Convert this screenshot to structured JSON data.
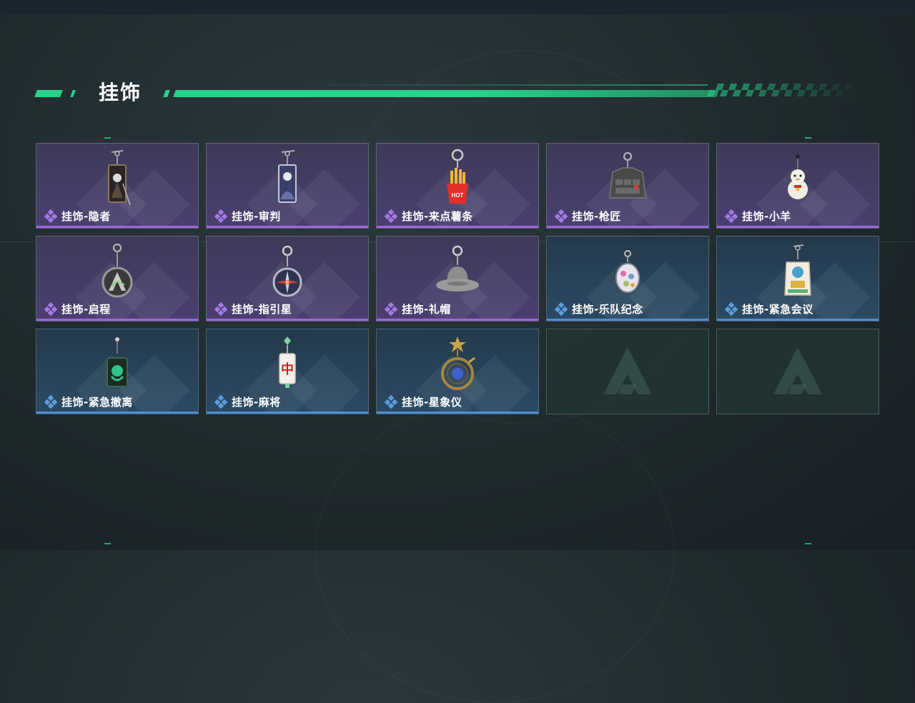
{
  "header": {
    "title": "挂饰"
  },
  "colors": {
    "accent": "#27d38b",
    "rare_purple": "#9a67e0",
    "rare_blue": "#4f8ed0"
  },
  "items": [
    {
      "label": "挂饰-隐者",
      "rarity": "purple",
      "icon": "tarot-card-hermit-charm-icon"
    },
    {
      "label": "挂饰-审判",
      "rarity": "purple",
      "icon": "tarot-card-judgement-charm-icon"
    },
    {
      "label": "挂饰-来点薯条",
      "rarity": "purple",
      "icon": "french-fries-charm-icon",
      "icon_text": "HOT"
    },
    {
      "label": "挂饰-枪匠",
      "rarity": "purple",
      "icon": "gunsmith-vest-charm-icon"
    },
    {
      "label": "挂饰-小羊",
      "rarity": "purple",
      "icon": "little-sheep-charm-icon"
    },
    {
      "label": "挂饰-启程",
      "rarity": "purple",
      "icon": "departure-emblem-charm-icon"
    },
    {
      "label": "挂饰-指引星",
      "rarity": "purple",
      "icon": "guiding-star-compass-charm-icon"
    },
    {
      "label": "挂饰-礼帽",
      "rarity": "purple",
      "icon": "fedora-hat-charm-icon"
    },
    {
      "label": "挂饰-乐队纪念",
      "rarity": "blue",
      "icon": "band-badge-charm-icon"
    },
    {
      "label": "挂饰-紧急会议",
      "rarity": "blue",
      "icon": "emergency-meeting-charm-icon"
    },
    {
      "label": "挂饰-紧急撤离",
      "rarity": "blue",
      "icon": "emergency-evacuation-charm-icon"
    },
    {
      "label": "挂饰-麻将",
      "rarity": "blue",
      "icon": "mahjong-tile-charm-icon",
      "icon_text": "中"
    },
    {
      "label": "挂饰-星象仪",
      "rarity": "blue",
      "icon": "astrolabe-charm-icon"
    }
  ],
  "empty_slots": [
    {
      "icon": "game-logo-icon"
    },
    {
      "icon": "game-logo-icon"
    }
  ]
}
